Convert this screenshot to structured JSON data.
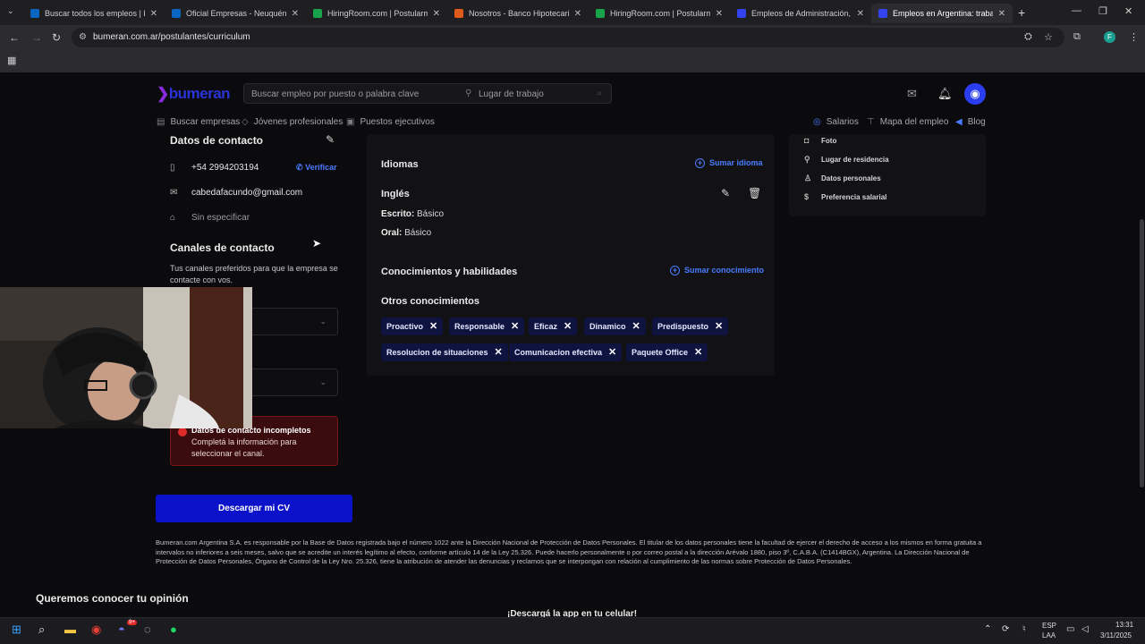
{
  "browser": {
    "tabs": [
      {
        "title": "Buscar todos los empleos | Link",
        "favicon_color": "#0a66c2",
        "favicon": "LinkedIn"
      },
      {
        "title": "Oficial Empresas - Neuquén | B",
        "favicon_color": "#0a66c2",
        "favicon": "LinkedIn"
      },
      {
        "title": "HiringRoom.com | Postularme",
        "favicon_color": "#19a34b",
        "favicon": "HiringRoom"
      },
      {
        "title": "Nosotros - Banco Hipotecario",
        "favicon_color": "#e05a1b",
        "favicon": "Banco Hipotecario"
      },
      {
        "title": "HiringRoom.com | Postularme",
        "favicon_color": "#19a34b",
        "favicon": "HiringRoom"
      },
      {
        "title": "Empleos de Administración, Co",
        "favicon_color": "#3344ee",
        "favicon": "Bumeran"
      },
      {
        "title": "Empleos en Argentina: trabajo",
        "favicon_color": "#3344ee",
        "favicon": "Bumeran",
        "active": true
      }
    ],
    "url": "bumeran.com.ar/postulantes/curriculum",
    "profile_initial": "F"
  },
  "site": {
    "logo": "bumeran",
    "search_placeholder": "Buscar empleo por puesto o palabra clave",
    "location_placeholder": "Lugar de trabajo",
    "subnav_left": [
      "Buscar empresas",
      "Jóvenes profesionales",
      "Puestos ejecutivos"
    ],
    "subnav_right": [
      "Salarios",
      "Mapa del empleo",
      "Blog"
    ]
  },
  "contact": {
    "title": "Datos de contacto",
    "phone": "+54 2994203194",
    "verify": "Verificar",
    "email": "cabedafacundo@gmail.com",
    "address": "Sin especificar",
    "channels_title": "Canales de contacto",
    "channels_desc": "Tus canales preferidos para que la empresa se contacte con vos.",
    "alert_bold": "Datos de contacto incompletos",
    "alert_text": "Completá la información para seleccionar el canal.",
    "download_cv": "Descargar mi CV"
  },
  "languages": {
    "title": "Idiomas",
    "add": "Sumar idioma",
    "lang": "Inglés",
    "written_label": "Escrito:",
    "written_value": "Básico",
    "oral_label": "Oral:",
    "oral_value": "Básico"
  },
  "skills": {
    "title": "Conocimientos y habilidades",
    "add": "Sumar conocimiento",
    "other_title": "Otros conocimientos",
    "chips": [
      "Proactivo",
      "Responsable",
      "Eficaz",
      "Dinamico",
      "Predispuesto",
      "Resolucion de situaciones",
      "Comunicacion efectiva",
      "Paquete Office"
    ]
  },
  "right_menu": [
    "Foto",
    "Lugar de residencia",
    "Datos personales",
    "Preferencia salarial"
  ],
  "footer": {
    "legal": "Bumeran.com Argentina S.A. es responsable por la Base de Datos registrada bajo el número 1022 ante la Dirección Nacional de Protección de Datos Personales. El titular de los datos personales tiene la facultad de ejercer el derecho de acceso a los mismos en forma gratuita a intervalos no inferiores a seis meses, salvo que se acredite un interés legítimo al efecto, conforme artículo 14 de la Ley 25.326. Puede hacerlo personalmente o por correo postal a la dirección Arévalo 1880, piso 3º, C.A.B.A. (C1414BGX), Argentina. La Dirección Nacional de Protección de Datos Personales, Órgano de Control de la Ley Nro. 25.326, tiene la atribución de atender las denuncias y reclamos que se interpongan con relación al cumplimiento de las normas sobre Protección de Datos Personales.",
    "opinion": "Queremos conocer tu opinión",
    "app": "¡Descargá la app en tu celular!"
  },
  "taskbar": {
    "lang1": "ESP",
    "lang2": "LAA",
    "time": "13:31",
    "date": "3/11/2025",
    "badge": "9+"
  }
}
